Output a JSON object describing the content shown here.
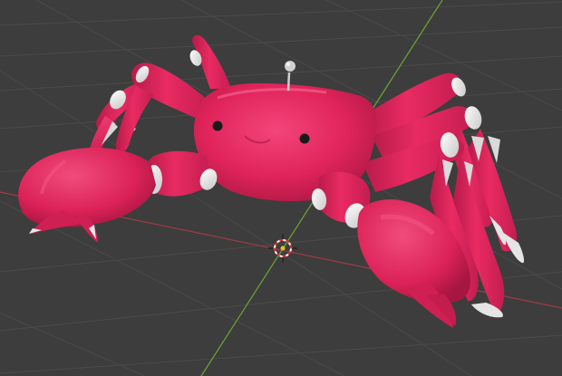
{
  "viewport": {
    "background_color": "#3d3d3d",
    "grid_color": "#4a4a4a",
    "x_axis_color": "#9e3b48",
    "y_axis_color": "#6ea533",
    "cursor_icon": "3d-cursor-icon"
  },
  "model": {
    "object": "crab",
    "body_color": "#e0245a",
    "shadow_color": "#b01945",
    "highlight_color": "#f3457a",
    "joint_color": "#eeeeee",
    "eye_color": "#1a1a1a",
    "antenna_color": "#cfcfcf"
  }
}
